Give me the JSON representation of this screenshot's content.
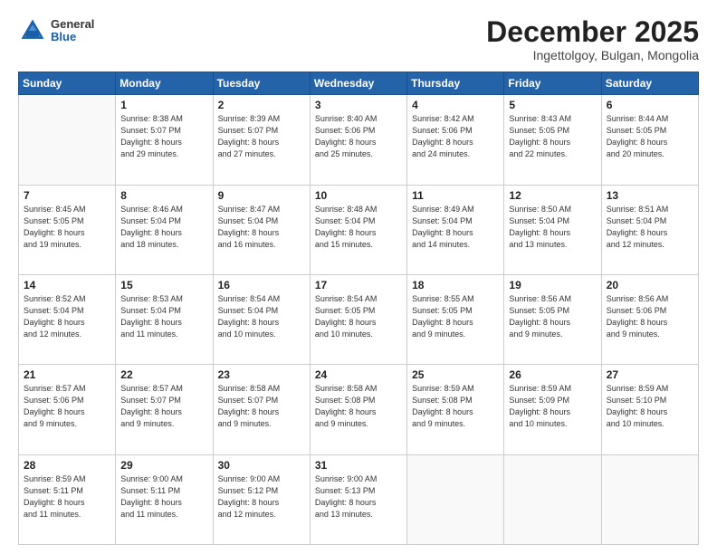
{
  "header": {
    "logo_general": "General",
    "logo_blue": "Blue",
    "month": "December 2025",
    "location": "Ingettolgoy, Bulgan, Mongolia"
  },
  "weekdays": [
    "Sunday",
    "Monday",
    "Tuesday",
    "Wednesday",
    "Thursday",
    "Friday",
    "Saturday"
  ],
  "weeks": [
    [
      {
        "day": "",
        "info": ""
      },
      {
        "day": "1",
        "info": "Sunrise: 8:38 AM\nSunset: 5:07 PM\nDaylight: 8 hours\nand 29 minutes."
      },
      {
        "day": "2",
        "info": "Sunrise: 8:39 AM\nSunset: 5:07 PM\nDaylight: 8 hours\nand 27 minutes."
      },
      {
        "day": "3",
        "info": "Sunrise: 8:40 AM\nSunset: 5:06 PM\nDaylight: 8 hours\nand 25 minutes."
      },
      {
        "day": "4",
        "info": "Sunrise: 8:42 AM\nSunset: 5:06 PM\nDaylight: 8 hours\nand 24 minutes."
      },
      {
        "day": "5",
        "info": "Sunrise: 8:43 AM\nSunset: 5:05 PM\nDaylight: 8 hours\nand 22 minutes."
      },
      {
        "day": "6",
        "info": "Sunrise: 8:44 AM\nSunset: 5:05 PM\nDaylight: 8 hours\nand 20 minutes."
      }
    ],
    [
      {
        "day": "7",
        "info": "Sunrise: 8:45 AM\nSunset: 5:05 PM\nDaylight: 8 hours\nand 19 minutes."
      },
      {
        "day": "8",
        "info": "Sunrise: 8:46 AM\nSunset: 5:04 PM\nDaylight: 8 hours\nand 18 minutes."
      },
      {
        "day": "9",
        "info": "Sunrise: 8:47 AM\nSunset: 5:04 PM\nDaylight: 8 hours\nand 16 minutes."
      },
      {
        "day": "10",
        "info": "Sunrise: 8:48 AM\nSunset: 5:04 PM\nDaylight: 8 hours\nand 15 minutes."
      },
      {
        "day": "11",
        "info": "Sunrise: 8:49 AM\nSunset: 5:04 PM\nDaylight: 8 hours\nand 14 minutes."
      },
      {
        "day": "12",
        "info": "Sunrise: 8:50 AM\nSunset: 5:04 PM\nDaylight: 8 hours\nand 13 minutes."
      },
      {
        "day": "13",
        "info": "Sunrise: 8:51 AM\nSunset: 5:04 PM\nDaylight: 8 hours\nand 12 minutes."
      }
    ],
    [
      {
        "day": "14",
        "info": "Sunrise: 8:52 AM\nSunset: 5:04 PM\nDaylight: 8 hours\nand 12 minutes."
      },
      {
        "day": "15",
        "info": "Sunrise: 8:53 AM\nSunset: 5:04 PM\nDaylight: 8 hours\nand 11 minutes."
      },
      {
        "day": "16",
        "info": "Sunrise: 8:54 AM\nSunset: 5:04 PM\nDaylight: 8 hours\nand 10 minutes."
      },
      {
        "day": "17",
        "info": "Sunrise: 8:54 AM\nSunset: 5:05 PM\nDaylight: 8 hours\nand 10 minutes."
      },
      {
        "day": "18",
        "info": "Sunrise: 8:55 AM\nSunset: 5:05 PM\nDaylight: 8 hours\nand 9 minutes."
      },
      {
        "day": "19",
        "info": "Sunrise: 8:56 AM\nSunset: 5:05 PM\nDaylight: 8 hours\nand 9 minutes."
      },
      {
        "day": "20",
        "info": "Sunrise: 8:56 AM\nSunset: 5:06 PM\nDaylight: 8 hours\nand 9 minutes."
      }
    ],
    [
      {
        "day": "21",
        "info": "Sunrise: 8:57 AM\nSunset: 5:06 PM\nDaylight: 8 hours\nand 9 minutes."
      },
      {
        "day": "22",
        "info": "Sunrise: 8:57 AM\nSunset: 5:07 PM\nDaylight: 8 hours\nand 9 minutes."
      },
      {
        "day": "23",
        "info": "Sunrise: 8:58 AM\nSunset: 5:07 PM\nDaylight: 8 hours\nand 9 minutes."
      },
      {
        "day": "24",
        "info": "Sunrise: 8:58 AM\nSunset: 5:08 PM\nDaylight: 8 hours\nand 9 minutes."
      },
      {
        "day": "25",
        "info": "Sunrise: 8:59 AM\nSunset: 5:08 PM\nDaylight: 8 hours\nand 9 minutes."
      },
      {
        "day": "26",
        "info": "Sunrise: 8:59 AM\nSunset: 5:09 PM\nDaylight: 8 hours\nand 10 minutes."
      },
      {
        "day": "27",
        "info": "Sunrise: 8:59 AM\nSunset: 5:10 PM\nDaylight: 8 hours\nand 10 minutes."
      }
    ],
    [
      {
        "day": "28",
        "info": "Sunrise: 8:59 AM\nSunset: 5:11 PM\nDaylight: 8 hours\nand 11 minutes."
      },
      {
        "day": "29",
        "info": "Sunrise: 9:00 AM\nSunset: 5:11 PM\nDaylight: 8 hours\nand 11 minutes."
      },
      {
        "day": "30",
        "info": "Sunrise: 9:00 AM\nSunset: 5:12 PM\nDaylight: 8 hours\nand 12 minutes."
      },
      {
        "day": "31",
        "info": "Sunrise: 9:00 AM\nSunset: 5:13 PM\nDaylight: 8 hours\nand 13 minutes."
      },
      {
        "day": "",
        "info": ""
      },
      {
        "day": "",
        "info": ""
      },
      {
        "day": "",
        "info": ""
      }
    ]
  ]
}
